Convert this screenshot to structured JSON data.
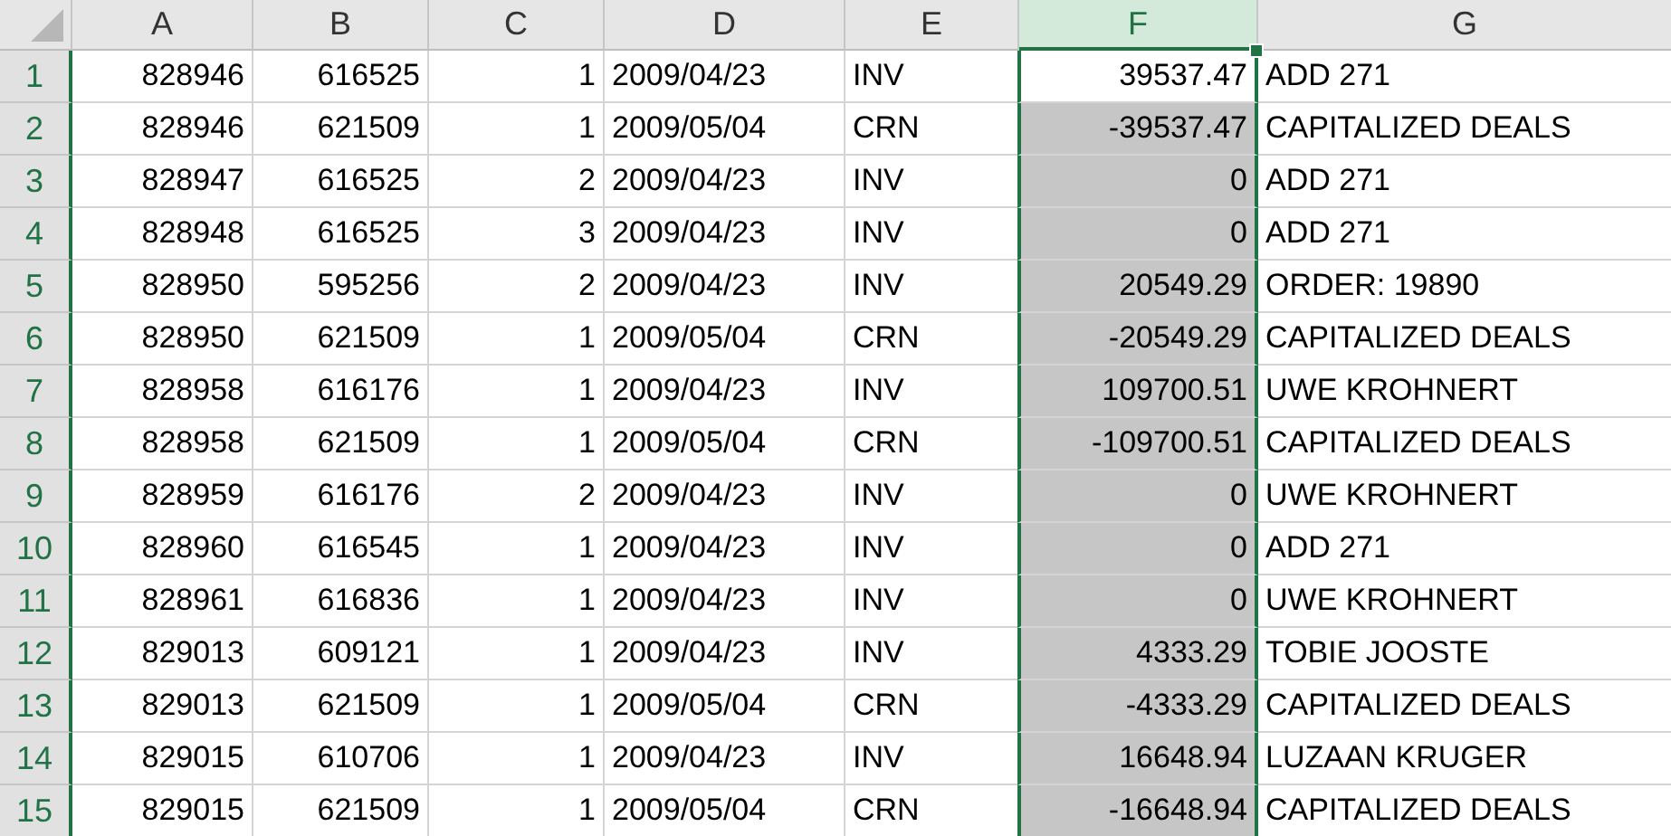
{
  "columns": [
    {
      "label": "A",
      "kind": "number",
      "selected": false
    },
    {
      "label": "B",
      "kind": "number",
      "selected": false
    },
    {
      "label": "C",
      "kind": "number",
      "selected": false
    },
    {
      "label": "D",
      "kind": "text",
      "selected": false
    },
    {
      "label": "E",
      "kind": "text",
      "selected": false
    },
    {
      "label": "F",
      "kind": "number",
      "selected": true
    },
    {
      "label": "G",
      "kind": "text",
      "selected": false
    }
  ],
  "rows": [
    {
      "number": "1",
      "selected": true,
      "active": true,
      "cells": [
        "828946",
        "616525",
        "1",
        "2009/04/23",
        "INV",
        "39537.47",
        "ADD 271"
      ]
    },
    {
      "number": "2",
      "selected": true,
      "active": false,
      "cells": [
        "828946",
        "621509",
        "1",
        "2009/05/04",
        "CRN",
        "-39537.47",
        "CAPITALIZED DEALS"
      ]
    },
    {
      "number": "3",
      "selected": true,
      "active": false,
      "cells": [
        "828947",
        "616525",
        "2",
        "2009/04/23",
        "INV",
        "0",
        "ADD 271"
      ]
    },
    {
      "number": "4",
      "selected": true,
      "active": false,
      "cells": [
        "828948",
        "616525",
        "3",
        "2009/04/23",
        "INV",
        "0",
        "ADD 271"
      ]
    },
    {
      "number": "5",
      "selected": true,
      "active": false,
      "cells": [
        "828950",
        "595256",
        "2",
        "2009/04/23",
        "INV",
        "20549.29",
        "ORDER: 19890"
      ]
    },
    {
      "number": "6",
      "selected": true,
      "active": false,
      "cells": [
        "828950",
        "621509",
        "1",
        "2009/05/04",
        "CRN",
        "-20549.29",
        "CAPITALIZED DEALS"
      ]
    },
    {
      "number": "7",
      "selected": true,
      "active": false,
      "cells": [
        "828958",
        "616176",
        "1",
        "2009/04/23",
        "INV",
        "109700.51",
        "UWE KROHNERT"
      ]
    },
    {
      "number": "8",
      "selected": true,
      "active": false,
      "cells": [
        "828958",
        "621509",
        "1",
        "2009/05/04",
        "CRN",
        "-109700.51",
        "CAPITALIZED DEALS"
      ]
    },
    {
      "number": "9",
      "selected": true,
      "active": false,
      "cells": [
        "828959",
        "616176",
        "2",
        "2009/04/23",
        "INV",
        "0",
        "UWE KROHNERT"
      ]
    },
    {
      "number": "10",
      "selected": true,
      "active": false,
      "cells": [
        "828960",
        "616545",
        "1",
        "2009/04/23",
        "INV",
        "0",
        "ADD 271"
      ]
    },
    {
      "number": "11",
      "selected": true,
      "active": false,
      "cells": [
        "828961",
        "616836",
        "1",
        "2009/04/23",
        "INV",
        "0",
        "UWE KROHNERT"
      ]
    },
    {
      "number": "12",
      "selected": true,
      "active": false,
      "cells": [
        "829013",
        "609121",
        "1",
        "2009/04/23",
        "INV",
        "4333.29",
        "TOBIE JOOSTE"
      ]
    },
    {
      "number": "13",
      "selected": true,
      "active": false,
      "cells": [
        "829013",
        "621509",
        "1",
        "2009/05/04",
        "CRN",
        "-4333.29",
        "CAPITALIZED DEALS"
      ]
    },
    {
      "number": "14",
      "selected": true,
      "active": false,
      "cells": [
        "829015",
        "610706",
        "1",
        "2009/04/23",
        "INV",
        "16648.94",
        "LUZAAN KRUGER"
      ]
    },
    {
      "number": "15",
      "selected": true,
      "active": false,
      "cells": [
        "829015",
        "621509",
        "1",
        "2009/05/04",
        "CRN",
        "-16648.94",
        "CAPITALIZED DEALS"
      ]
    }
  ]
}
